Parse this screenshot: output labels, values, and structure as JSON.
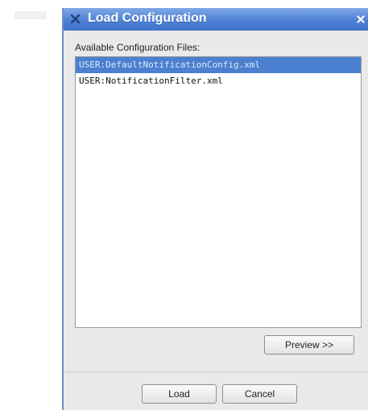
{
  "dialog": {
    "title": "Load Configuration",
    "list_label": "Available Configuration Files:",
    "files": [
      {
        "name": "USER:DefaultNotificationConfig.xml",
        "selected": true
      },
      {
        "name": "USER:NotificationFilter.xml",
        "selected": false
      }
    ],
    "preview_label": "Preview >>",
    "load_label": "Load",
    "cancel_label": "Cancel",
    "icons": {
      "app": "app-x-icon",
      "close": "close-icon"
    }
  },
  "colors": {
    "titlebar": "#4f82d6",
    "selection": "#4a80cf",
    "dialog_bg": "#e9e9e9"
  }
}
